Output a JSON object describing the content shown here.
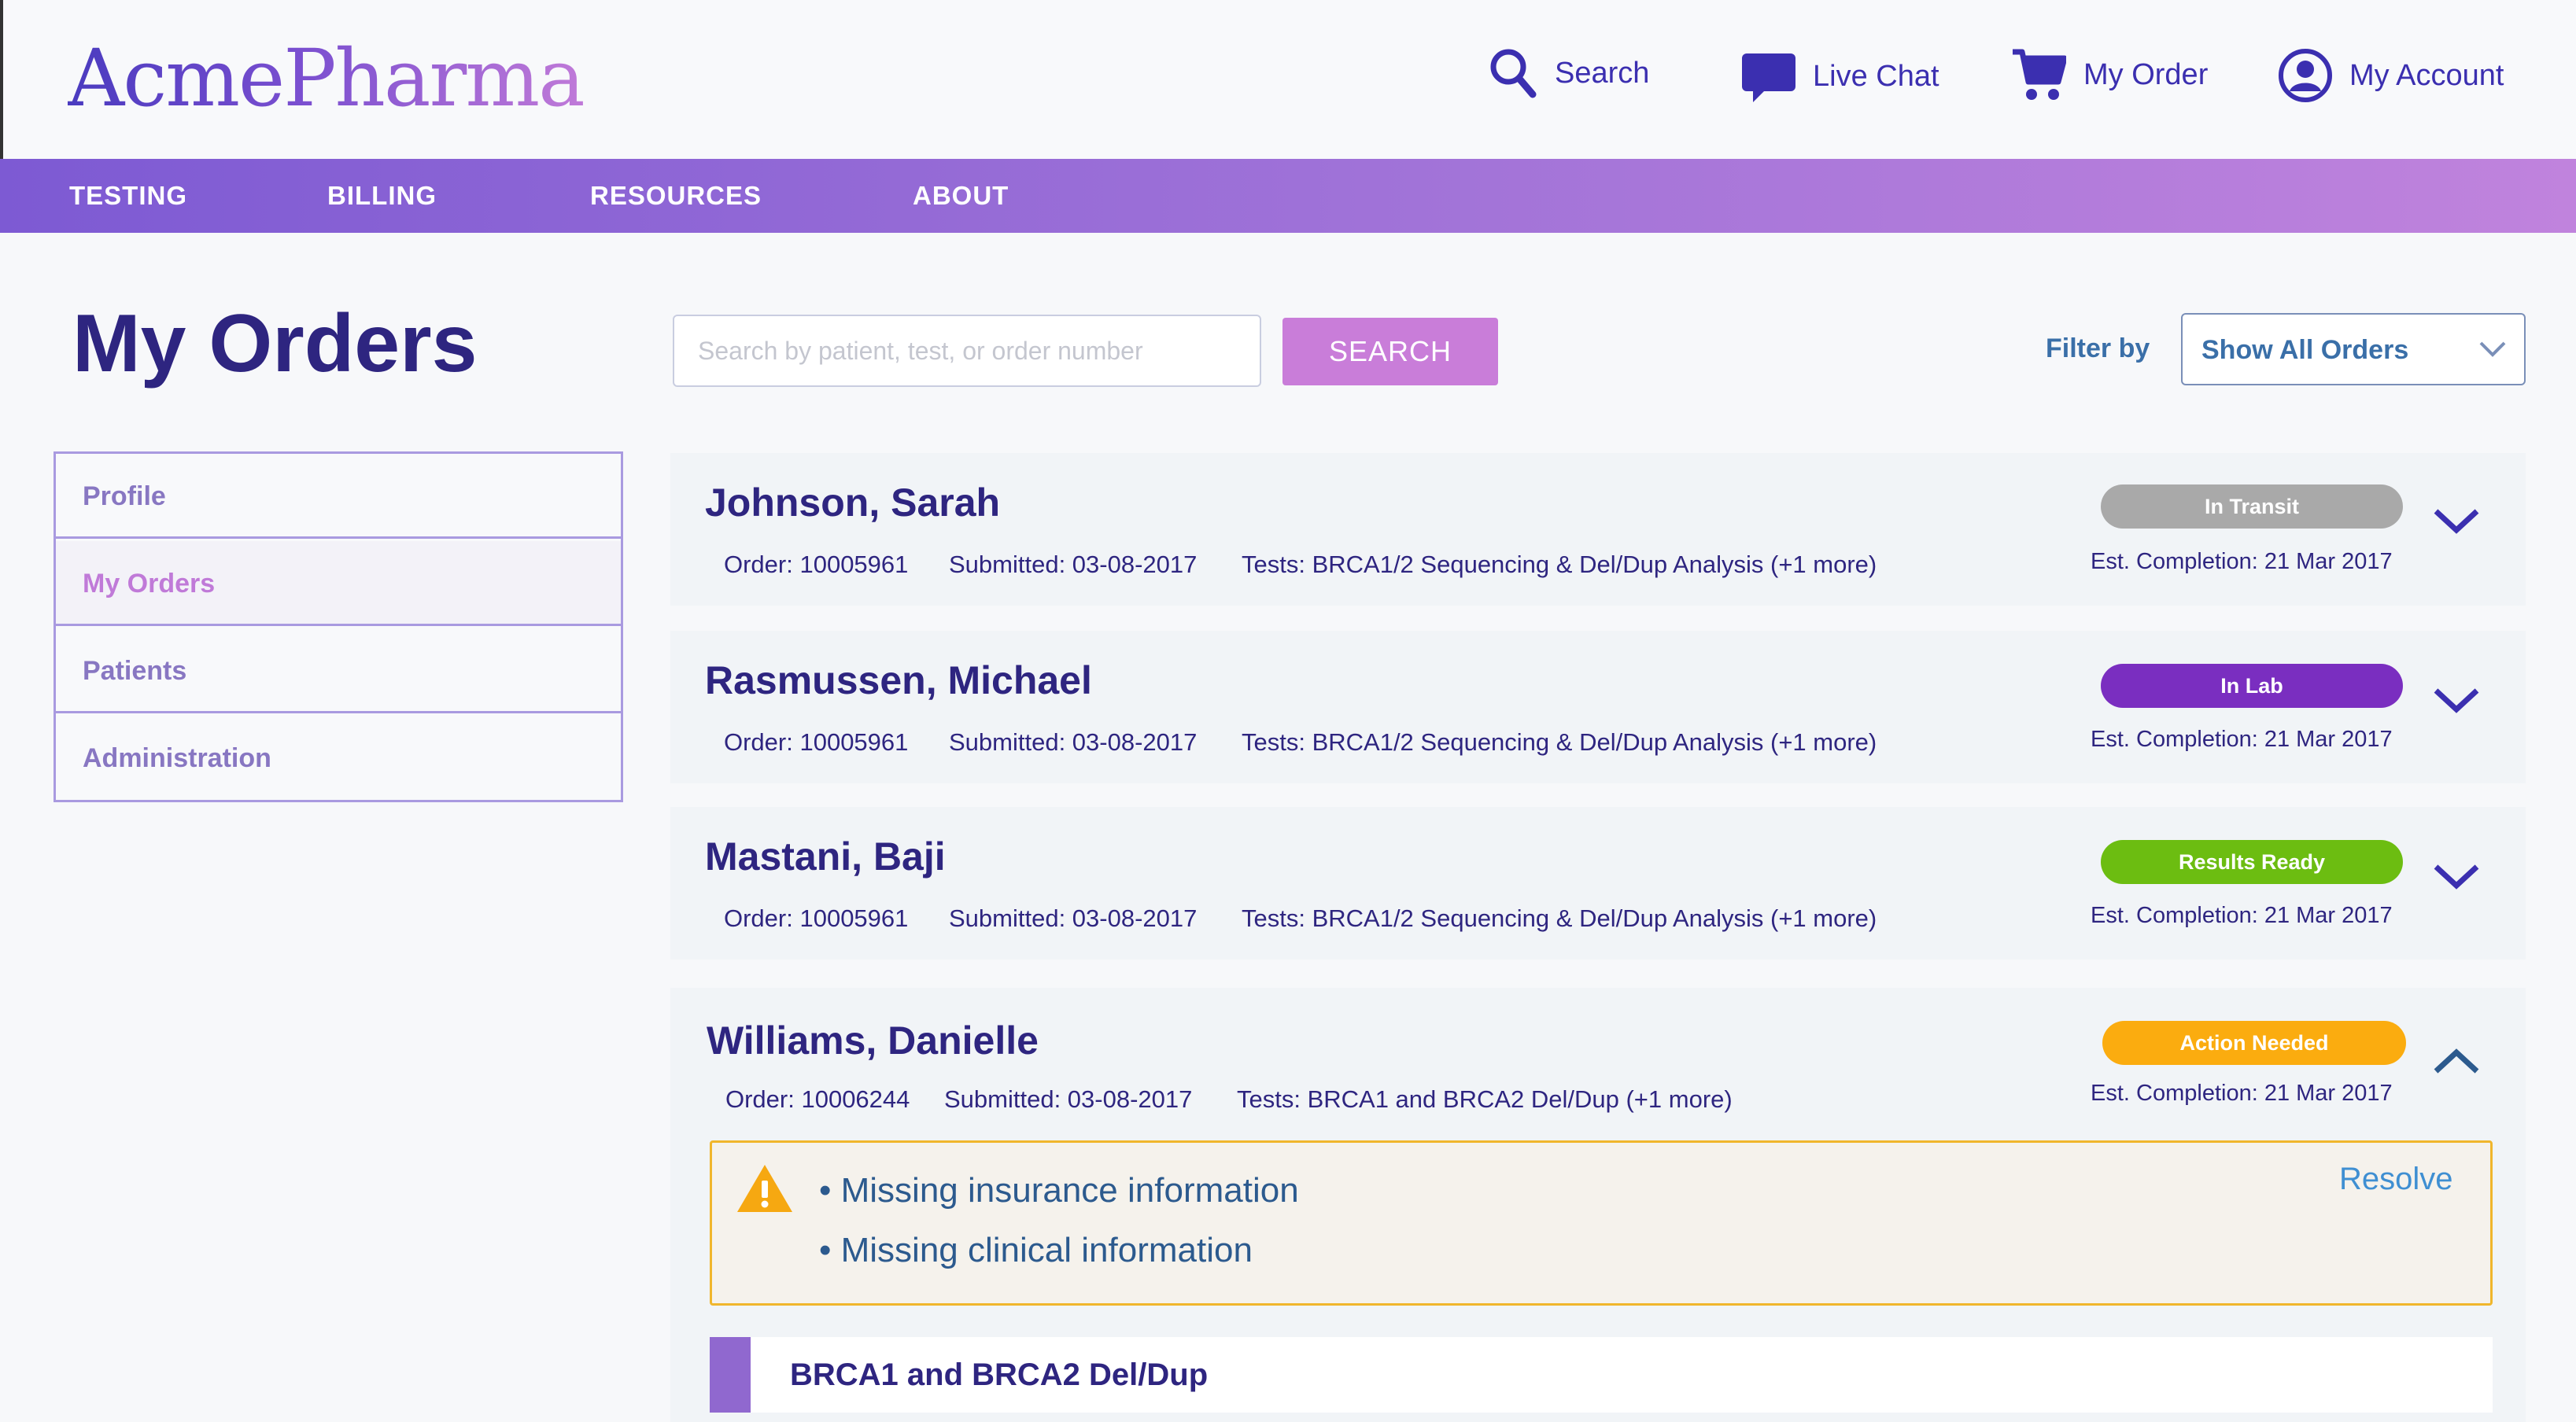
{
  "header": {
    "logo": "AcmePharma",
    "links": [
      {
        "label": "Search",
        "icon": "search-icon"
      },
      {
        "label": "Live Chat",
        "icon": "chat-icon"
      },
      {
        "label": "My Order",
        "icon": "cart-icon"
      },
      {
        "label": "My Account",
        "icon": "account-icon"
      }
    ]
  },
  "nav": [
    "TESTING",
    "BILLING",
    "RESOURCES",
    "ABOUT"
  ],
  "page": {
    "title": "My Orders",
    "search_placeholder": "Search by patient, test, or order number",
    "search_button": "SEARCH",
    "filter_label": "Filter by",
    "filter_value": "Show All Orders"
  },
  "sidebar": [
    "Profile",
    "My Orders",
    "Patients",
    "Administration"
  ],
  "orders": [
    {
      "name": "Johnson, Sarah",
      "order": "Order: 10005961",
      "submitted": "Submitted: 03-08-2017",
      "tests": "Tests: BRCA1/2 Sequencing & Del/Dup Analysis (+1 more)",
      "status": "In Transit",
      "status_color": "#a9a9a9",
      "est": "Est. Completion: 21 Mar 2017"
    },
    {
      "name": "Rasmussen, Michael",
      "order": "Order: 10005961",
      "submitted": "Submitted: 03-08-2017",
      "tests": "Tests: BRCA1/2 Sequencing & Del/Dup Analysis (+1 more)",
      "status": "In Lab",
      "status_color": "#7a2ec0",
      "est": "Est. Completion: 21 Mar 2017"
    },
    {
      "name": "Mastani, Baji",
      "order": "Order: 10005961",
      "submitted": "Submitted: 03-08-2017",
      "tests": "Tests: BRCA1/2 Sequencing & Del/Dup Analysis (+1 more)",
      "status": "Results Ready",
      "status_color": "#6cbd11",
      "est": "Est. Completion: 21 Mar 2017"
    },
    {
      "name": "Williams, Danielle",
      "order": "Order: 10006244",
      "submitted": "Submitted: 03-08-2017",
      "tests": "Tests: BRCA1 and BRCA2 Del/Dup (+1 more)",
      "status": "Action Needed",
      "status_color": "#fbac0f",
      "est": "Est. Completion: 21 Mar 2017",
      "alerts": [
        "• Missing insurance information",
        "• Missing clinical information"
      ],
      "resolve": "Resolve",
      "test_item": "BRCA1 and BRCA2 Del/Dup"
    }
  ],
  "colors": {
    "brand_dark": "#2e2580",
    "nav_gradient_start": "#7d5ad3",
    "nav_gradient_end": "#c083dd",
    "accent_pink": "#c97dd9",
    "warning": "#f0b62c",
    "link_blue": "#3f8fd2"
  }
}
